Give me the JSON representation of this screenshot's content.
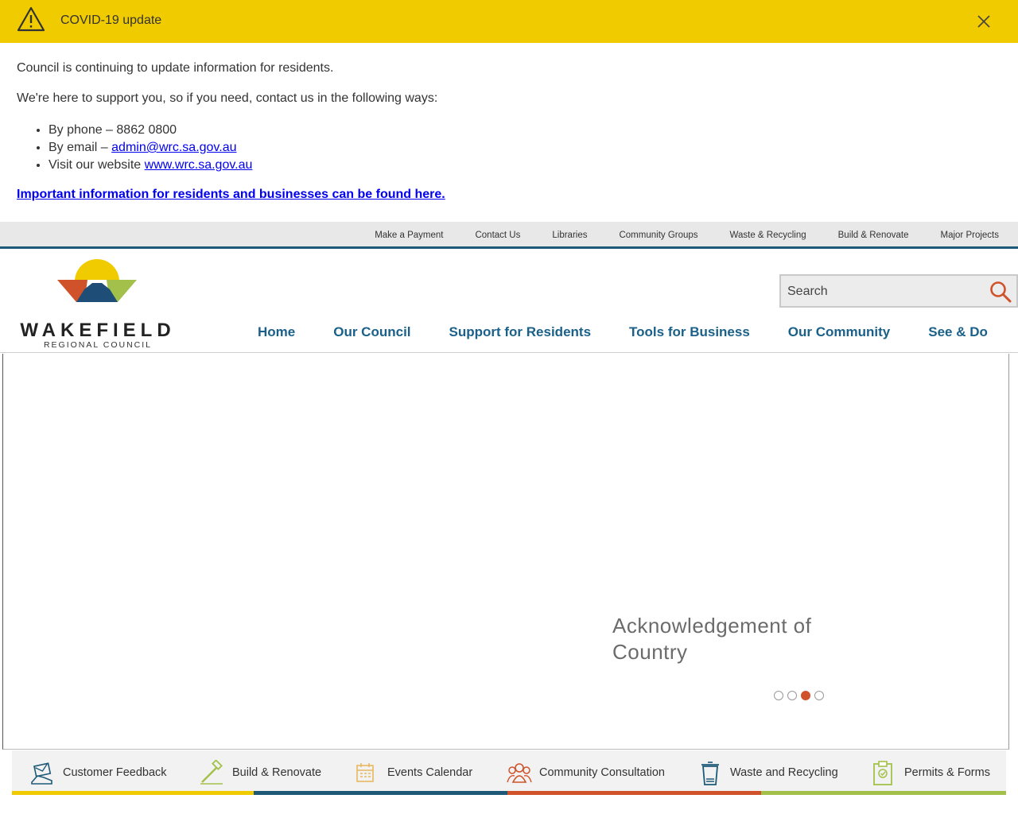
{
  "alert": {
    "title": "COVID-19 update",
    "paragraph1": "Council is continuing to update information for residents.",
    "paragraph2": "We're here to support you, so if you need, contact us in the following ways:",
    "phone_prefix": "By phone – 8862 0800",
    "email_prefix": "By email – ",
    "email_link": "admin@wrc.sa.gov.au",
    "website_prefix": "Visit our website ",
    "website_link": "www.wrc.sa.gov.au",
    "important_link": "Important information for residents and businesses can be found here."
  },
  "utility_nav": {
    "items": [
      "Make a Payment",
      "Contact Us",
      "Libraries",
      "Community Groups",
      "Waste & Recycling",
      "Build & Renovate",
      "Major Projects"
    ]
  },
  "logo": {
    "wordmark": "WAKEFIELD",
    "subline": "REGIONAL COUNCIL"
  },
  "search": {
    "placeholder": "Search"
  },
  "main_nav": {
    "items": [
      "Home",
      "Our Council",
      "Support for Residents",
      "Tools for Business",
      "Our Community",
      "See & Do"
    ]
  },
  "hero": {
    "title": "Acknowledgement of Country",
    "slide_count": 4,
    "active_slide": 3
  },
  "quick_links": {
    "items": [
      {
        "label": "Customer Feedback",
        "icon": "envelope-hand-icon"
      },
      {
        "label": "Build & Renovate",
        "icon": "hammer-icon"
      },
      {
        "label": "Events Calendar",
        "icon": "calendar-icon"
      },
      {
        "label": "Community Consultation",
        "icon": "people-group-icon"
      },
      {
        "label": "Waste and Recycling",
        "icon": "bin-icon"
      },
      {
        "label": "Permits & Forms",
        "icon": "clipboard-check-icon"
      }
    ]
  },
  "colors": {
    "alert_bg": "#f0cb00",
    "nav_blue": "#1a6089",
    "accent_orange": "#d0522a",
    "accent_yellow": "#f0cb00",
    "accent_navy": "#1e5a78",
    "accent_green": "#a3c14a"
  }
}
